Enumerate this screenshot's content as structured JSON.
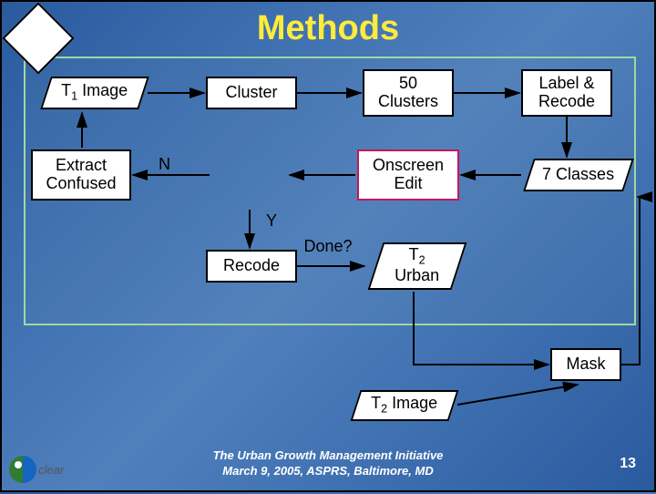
{
  "title": "Methods",
  "nodes": {
    "t1_image": "T₁ Image",
    "cluster": "Cluster",
    "fifty_clusters": "50 Clusters",
    "label_recode": "Label & Recode",
    "extract_confused": "Extract Confused",
    "done": "Done?",
    "onscreen_edit": "Onscreen Edit",
    "seven_classes": "7 Classes",
    "recode": "Recode",
    "t2_urban": "T₂ Urban",
    "mask": "Mask",
    "t2_image": "T₂ Image"
  },
  "edge_labels": {
    "no": "N",
    "yes": "Y"
  },
  "footer": {
    "line1": "The Urban Growth Management Initiative",
    "line2": "March 9, 2005, ASPRS, Baltimore, MD"
  },
  "page_number": "13",
  "logo_text": "clear"
}
